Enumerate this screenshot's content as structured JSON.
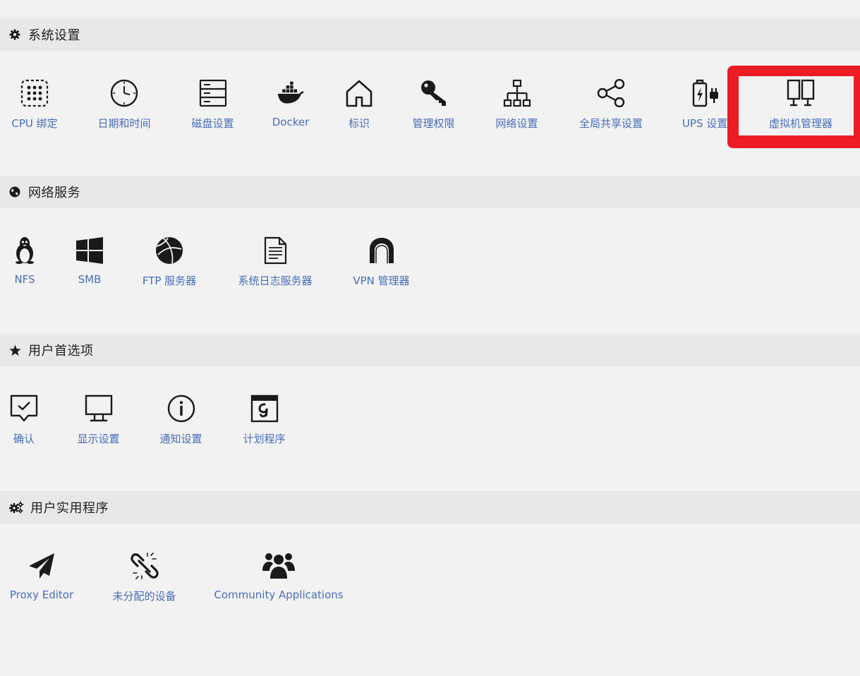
{
  "sections": [
    {
      "title": "系统设置",
      "icon": "gear-icon",
      "items": [
        {
          "label": "CPU 绑定",
          "icon": "cpu-grid-icon"
        },
        {
          "label": "日期和时间",
          "icon": "clock-icon"
        },
        {
          "label": "磁盘设置",
          "icon": "disk-stack-icon"
        },
        {
          "label": "Docker",
          "icon": "docker-whale-icon"
        },
        {
          "label": "标识",
          "icon": "home-icon"
        },
        {
          "label": "管理权限",
          "icon": "key-icon"
        },
        {
          "label": "网络设置",
          "icon": "network-tree-icon"
        },
        {
          "label": "全局共享设置",
          "icon": "share-icon"
        },
        {
          "label": "UPS 设置",
          "icon": "battery-plug-icon"
        },
        {
          "label": "虚拟机管理器",
          "icon": "vm-monitors-icon"
        }
      ]
    },
    {
      "title": "网络服务",
      "icon": "globe-icon",
      "items": [
        {
          "label": "NFS",
          "icon": "linux-penguin-icon"
        },
        {
          "label": "SMB",
          "icon": "windows-icon"
        },
        {
          "label": "FTP 服务器",
          "icon": "ftp-globe-icon"
        },
        {
          "label": "系统日志服务器",
          "icon": "log-document-icon"
        },
        {
          "label": "VPN 管理器",
          "icon": "vpn-tunnel-icon"
        }
      ]
    },
    {
      "title": "用户首选项",
      "icon": "star-icon",
      "items": [
        {
          "label": "确认",
          "icon": "confirm-speech-icon"
        },
        {
          "label": "显示设置",
          "icon": "monitor-icon"
        },
        {
          "label": "通知设置",
          "icon": "info-icon"
        },
        {
          "label": "计划程序",
          "icon": "calendar-icon"
        }
      ]
    },
    {
      "title": "用户实用程序",
      "icon": "gears-icon",
      "items": [
        {
          "label": "Proxy Editor",
          "icon": "paper-plane-icon"
        },
        {
          "label": "未分配的设备",
          "icon": "broken-link-icon"
        },
        {
          "label": "Community Applications",
          "icon": "users-group-icon"
        }
      ]
    }
  ],
  "colors": {
    "label": "#486dba",
    "header_bg": "#e8e8e8",
    "page_bg": "#f2f2f2",
    "highlight": "#ec1c24"
  }
}
